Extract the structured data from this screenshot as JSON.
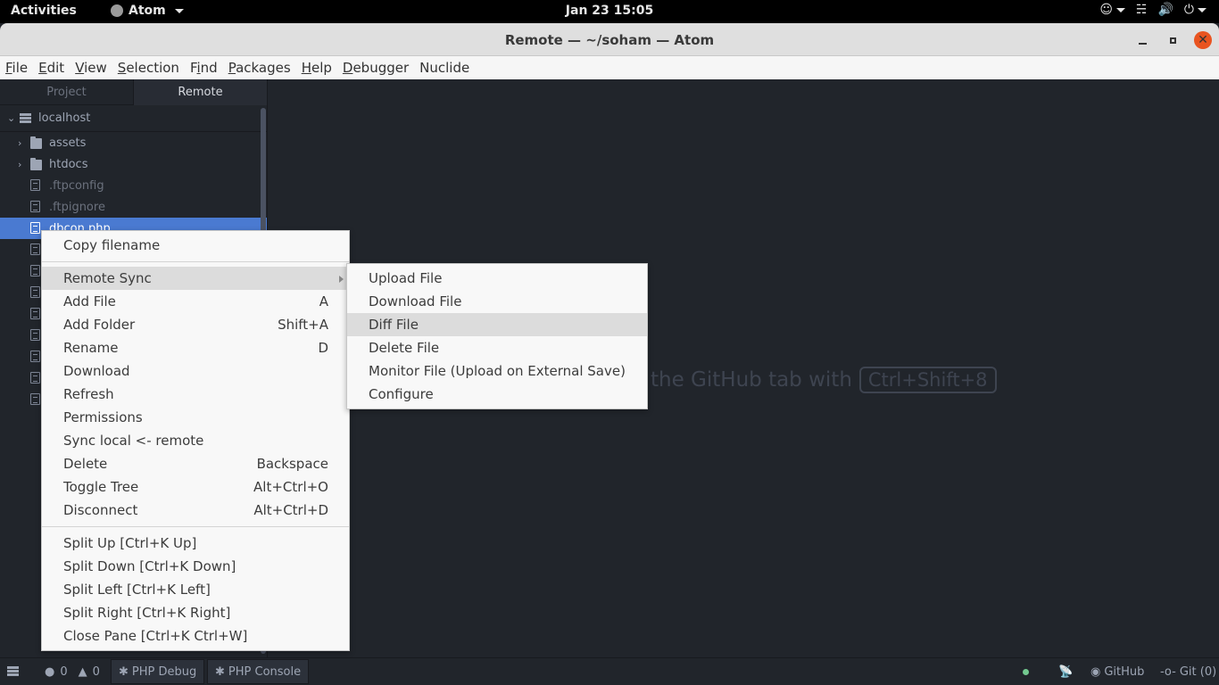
{
  "topbar": {
    "activities": "Activities",
    "app_name": "Atom",
    "clock": "Jan 23  15:05",
    "tray_icons": [
      "accessibility-icon",
      "network-icon",
      "volume-icon",
      "power-icon"
    ]
  },
  "window": {
    "title": "Remote — ~/soham — Atom",
    "buttons": [
      "minimize",
      "maximize",
      "close"
    ]
  },
  "menubar": {
    "items": [
      {
        "label": "File",
        "mnemonic": "F",
        "rest": "ile"
      },
      {
        "label": "Edit",
        "mnemonic": "E",
        "rest": "dit"
      },
      {
        "label": "View",
        "mnemonic": "V",
        "rest": "iew"
      },
      {
        "label": "Selection",
        "mnemonic": "S",
        "rest": "election"
      },
      {
        "label": "Find",
        "pre": "F",
        "mnemonic": "i",
        "rest": "nd"
      },
      {
        "label": "Packages",
        "mnemonic": "P",
        "rest": "ackages"
      },
      {
        "label": "Help",
        "mnemonic": "H",
        "rest": "elp"
      },
      {
        "label": "Debugger",
        "mnemonic": "D",
        "rest": "ebugger"
      },
      {
        "label": "Nuclide",
        "mnemonic": "",
        "rest": "Nuclide"
      }
    ]
  },
  "sidebar": {
    "tabs": [
      {
        "label": "Project",
        "active": false
      },
      {
        "label": "Remote",
        "active": true
      }
    ],
    "root": {
      "label": "localhost",
      "expanded": true,
      "icon": "server-icon"
    },
    "items": [
      {
        "label": "assets",
        "type": "folder",
        "expanded": false
      },
      {
        "label": "htdocs",
        "type": "folder",
        "expanded": false
      },
      {
        "label": ".ftpconfig",
        "type": "file",
        "ignored": true
      },
      {
        "label": ".ftpignore",
        "type": "file",
        "ignored": true
      },
      {
        "label": "dbcon.php",
        "type": "file",
        "selected": true
      }
    ],
    "hidden_files_count": 8
  },
  "main": {
    "hint_text": "the GitHub tab with",
    "hint_key": "Ctrl+Shift+8"
  },
  "context_menu": {
    "items": [
      {
        "label": "Copy filename",
        "shortcut": ""
      },
      {
        "separator": true
      },
      {
        "label": "Remote Sync",
        "shortcut": "",
        "submenu": true,
        "highlighted": true
      },
      {
        "label": "Add File",
        "shortcut": "A"
      },
      {
        "label": "Add Folder",
        "shortcut": "Shift+A"
      },
      {
        "label": "Rename",
        "shortcut": "D"
      },
      {
        "label": "Download",
        "shortcut": ""
      },
      {
        "label": "Refresh",
        "shortcut": ""
      },
      {
        "label": "Permissions",
        "shortcut": ""
      },
      {
        "label": "Sync local <- remote",
        "shortcut": ""
      },
      {
        "label": "Delete",
        "shortcut": "Backspace"
      },
      {
        "label": "Toggle Tree",
        "shortcut": "Alt+Ctrl+O"
      },
      {
        "label": "Disconnect",
        "shortcut": "Alt+Ctrl+D"
      },
      {
        "separator": true
      },
      {
        "label": "Split Up [Ctrl+K Up]",
        "shortcut": ""
      },
      {
        "label": "Split Down [Ctrl+K Down]",
        "shortcut": ""
      },
      {
        "label": "Split Left [Ctrl+K Left]",
        "shortcut": ""
      },
      {
        "label": "Split Right [Ctrl+K Right]",
        "shortcut": ""
      },
      {
        "label": "Close Pane [Ctrl+K Ctrl+W]",
        "shortcut": ""
      }
    ]
  },
  "submenu": {
    "items": [
      {
        "label": "Upload File"
      },
      {
        "label": "Download File"
      },
      {
        "label": "Diff File",
        "highlighted": true
      },
      {
        "label": "Delete File"
      },
      {
        "label": "Monitor File (Upload on External Save)"
      },
      {
        "label": "Configure"
      }
    ]
  },
  "statusbar": {
    "errors": "0",
    "warnings": "0",
    "php_debug": "PHP Debug",
    "php_console": "PHP Console",
    "github": "GitHub",
    "git": "Git (0)",
    "status_dot_color": "#73c990"
  }
}
